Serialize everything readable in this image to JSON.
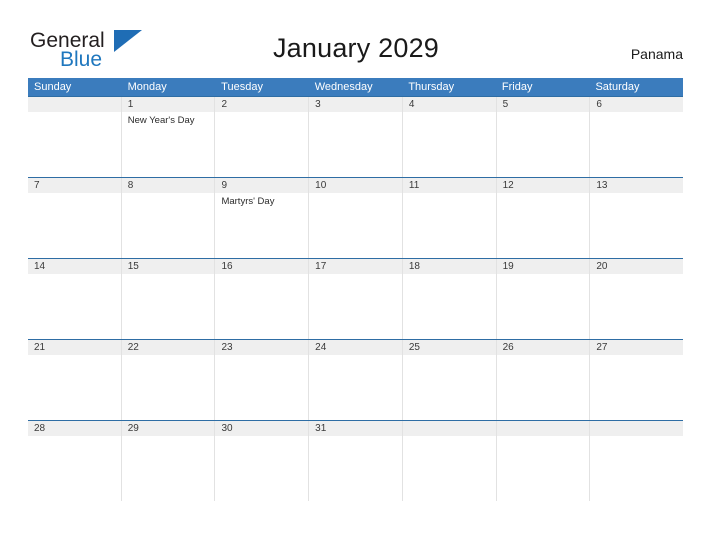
{
  "brand": {
    "name_part1": "General",
    "name_part2": "Blue",
    "triangle_icon": "triangle-icon",
    "accent_color": "#1f6db5"
  },
  "header": {
    "title": "January 2029",
    "country": "Panama"
  },
  "theme": {
    "header_blue": "#3b7cbd",
    "row_line_blue": "#2e6da4",
    "row_band_gray": "#efefef",
    "cell_divider": "#e2e2e2",
    "text_color": "#3a3a3a"
  },
  "calendar": {
    "weekday_headers": [
      "Sunday",
      "Monday",
      "Tuesday",
      "Wednesday",
      "Thursday",
      "Friday",
      "Saturday"
    ],
    "weeks": [
      {
        "days": [
          {
            "num": "",
            "events": []
          },
          {
            "num": "1",
            "events": [
              "New Year's Day"
            ]
          },
          {
            "num": "2",
            "events": []
          },
          {
            "num": "3",
            "events": []
          },
          {
            "num": "4",
            "events": []
          },
          {
            "num": "5",
            "events": []
          },
          {
            "num": "6",
            "events": []
          }
        ]
      },
      {
        "days": [
          {
            "num": "7",
            "events": []
          },
          {
            "num": "8",
            "events": []
          },
          {
            "num": "9",
            "events": [
              "Martyrs' Day"
            ]
          },
          {
            "num": "10",
            "events": []
          },
          {
            "num": "11",
            "events": []
          },
          {
            "num": "12",
            "events": []
          },
          {
            "num": "13",
            "events": []
          }
        ]
      },
      {
        "days": [
          {
            "num": "14",
            "events": []
          },
          {
            "num": "15",
            "events": []
          },
          {
            "num": "16",
            "events": []
          },
          {
            "num": "17",
            "events": []
          },
          {
            "num": "18",
            "events": []
          },
          {
            "num": "19",
            "events": []
          },
          {
            "num": "20",
            "events": []
          }
        ]
      },
      {
        "days": [
          {
            "num": "21",
            "events": []
          },
          {
            "num": "22",
            "events": []
          },
          {
            "num": "23",
            "events": []
          },
          {
            "num": "24",
            "events": []
          },
          {
            "num": "25",
            "events": []
          },
          {
            "num": "26",
            "events": []
          },
          {
            "num": "27",
            "events": []
          }
        ]
      },
      {
        "days": [
          {
            "num": "28",
            "events": []
          },
          {
            "num": "29",
            "events": []
          },
          {
            "num": "30",
            "events": []
          },
          {
            "num": "31",
            "events": []
          },
          {
            "num": "",
            "events": []
          },
          {
            "num": "",
            "events": []
          },
          {
            "num": "",
            "events": []
          }
        ]
      }
    ]
  }
}
